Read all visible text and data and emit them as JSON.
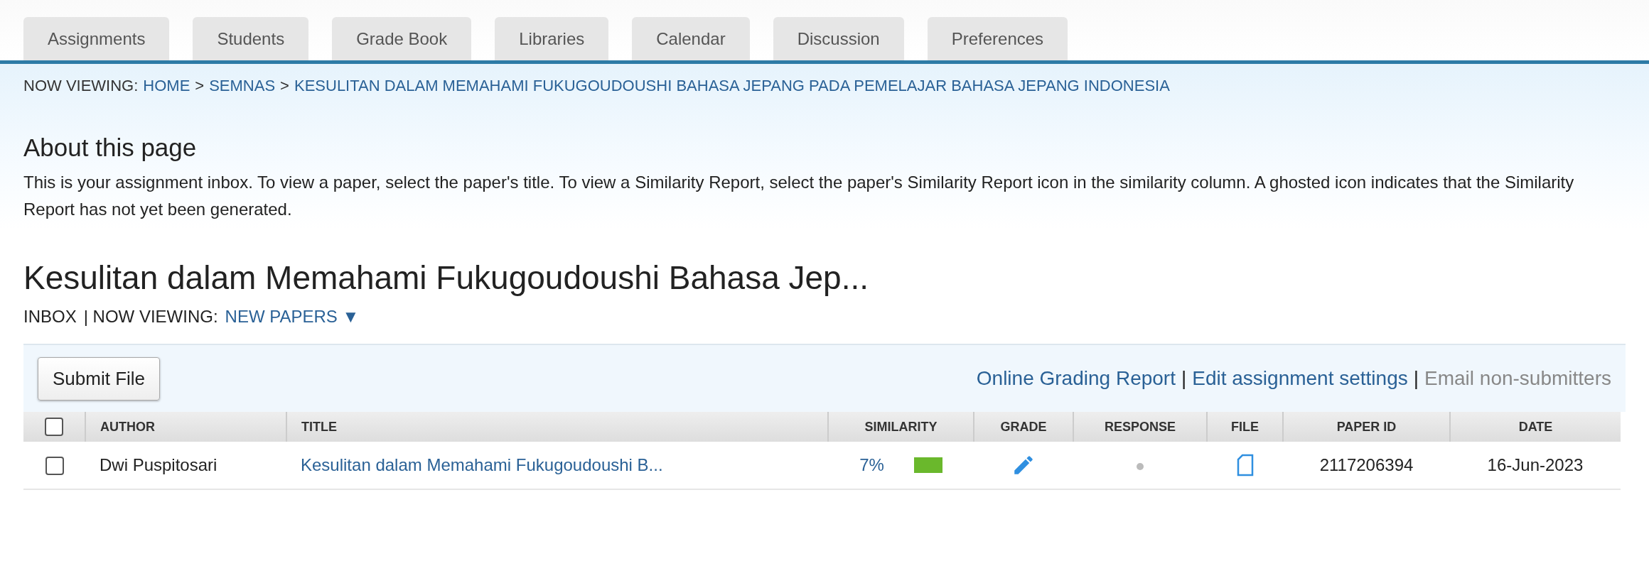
{
  "tabs": [
    {
      "label": "Assignments",
      "selected": false
    },
    {
      "label": "Students",
      "selected": false
    },
    {
      "label": "Grade Book",
      "selected": false
    },
    {
      "label": "Libraries",
      "selected": false
    },
    {
      "label": "Calendar",
      "selected": false
    },
    {
      "label": "Discussion",
      "selected": false
    },
    {
      "label": "Preferences",
      "selected": false
    }
  ],
  "breadcrumb": {
    "label": "NOW VIEWING:",
    "items": [
      "HOME",
      "SEMNAS",
      "KESULITAN DALAM MEMAHAMI FUKUGOUDOUSHI BAHASA JEPANG PADA PEMELAJAR BAHASA JEPANG INDONESIA"
    ],
    "separator": ">"
  },
  "about": {
    "heading": "About this page",
    "text": "This is your assignment inbox. To view a paper, select the paper's title. To view a Similarity Report, select the paper's Similarity Report icon in the similarity column. A ghosted icon indicates that the Similarity Report has not yet been generated."
  },
  "assignment_title": "Kesulitan dalam Memahami Fukugoudoushi Bahasa Jep...",
  "inbox": {
    "label": "INBOX",
    "viewing_label": "| NOW VIEWING:",
    "filter": "NEW PAPERS",
    "caret": "▼"
  },
  "toolbar": {
    "button": "Submit File",
    "links": [
      {
        "label": "Online Grading Report",
        "disabled": false
      },
      {
        "label": "Edit assignment settings",
        "disabled": false
      },
      {
        "label": "Email non-submitters",
        "disabled": true
      }
    ],
    "separator": "|"
  },
  "table": {
    "select_all_checked": false,
    "columns": [
      "AUTHOR",
      "TITLE",
      "SIMILARITY",
      "GRADE",
      "RESPONSE",
      "FILE",
      "PAPER ID",
      "DATE"
    ],
    "rows": [
      {
        "checked": false,
        "author": "Dwi Puspitosari",
        "title": "Kesulitan dalam Memahami Fukugoudoushi B...",
        "similarity": "7%",
        "color": "#6ab82c",
        "paper_id": "2117206394",
        "date": "16-Jun-2023"
      }
    ]
  }
}
